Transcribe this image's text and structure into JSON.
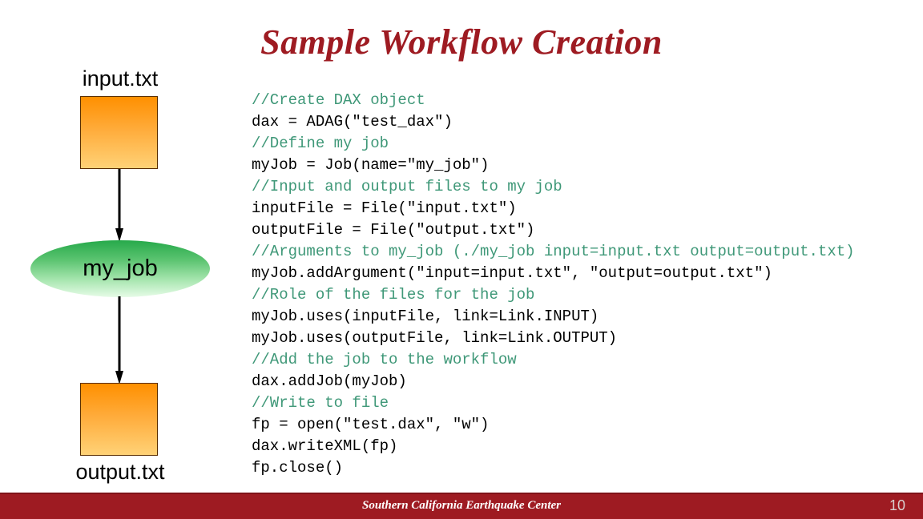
{
  "slide": {
    "title": "Sample Workflow Creation"
  },
  "diagram": {
    "input_label": "input.txt",
    "job_label": "my_job",
    "output_label": "output.txt",
    "colors": {
      "file_node_top": "#ff9000",
      "file_node_bottom": "#ffd277",
      "file_node_border": "#5a2d00",
      "job_node_top": "#26a94a",
      "job_node_bottom": "#e6fbe7",
      "edge": "#000000"
    }
  },
  "code": {
    "language": "python",
    "comment_color": "#3f9878",
    "code_color": "#000000",
    "lines": [
      {
        "type": "comment",
        "text": "//Create DAX object"
      },
      {
        "type": "code",
        "text": "dax = ADAG(\"test_dax\")"
      },
      {
        "type": "comment",
        "text": "//Define my job"
      },
      {
        "type": "code",
        "text": "myJob = Job(name=\"my_job\")"
      },
      {
        "type": "comment",
        "text": "//Input and output files to my job"
      },
      {
        "type": "code",
        "text": "inputFile = File(\"input.txt\")"
      },
      {
        "type": "code",
        "text": "outputFile = File(\"output.txt\")"
      },
      {
        "type": "comment",
        "text": "//Arguments to my_job (./my_job input=input.txt output=output.txt)"
      },
      {
        "type": "code",
        "text": "myJob.addArgument(\"input=input.txt\", \"output=output.txt\")"
      },
      {
        "type": "comment",
        "text": "//Role of the files for the job"
      },
      {
        "type": "code",
        "text": "myJob.uses(inputFile, link=Link.INPUT)"
      },
      {
        "type": "code",
        "text": "myJob.uses(outputFile, link=Link.OUTPUT)"
      },
      {
        "type": "comment",
        "text": "//Add the job to the workflow"
      },
      {
        "type": "code",
        "text": "dax.addJob(myJob)"
      },
      {
        "type": "comment",
        "text": "//Write to file"
      },
      {
        "type": "code",
        "text": "fp = open(\"test.dax\", \"w\")"
      },
      {
        "type": "code",
        "text": "dax.writeXML(fp)"
      },
      {
        "type": "code",
        "text": "fp.close()"
      }
    ]
  },
  "footer": {
    "title": "Southern California Earthquake Center",
    "page_number": "10",
    "background_color": "#9e1b22",
    "text_color": "#ffffff"
  }
}
